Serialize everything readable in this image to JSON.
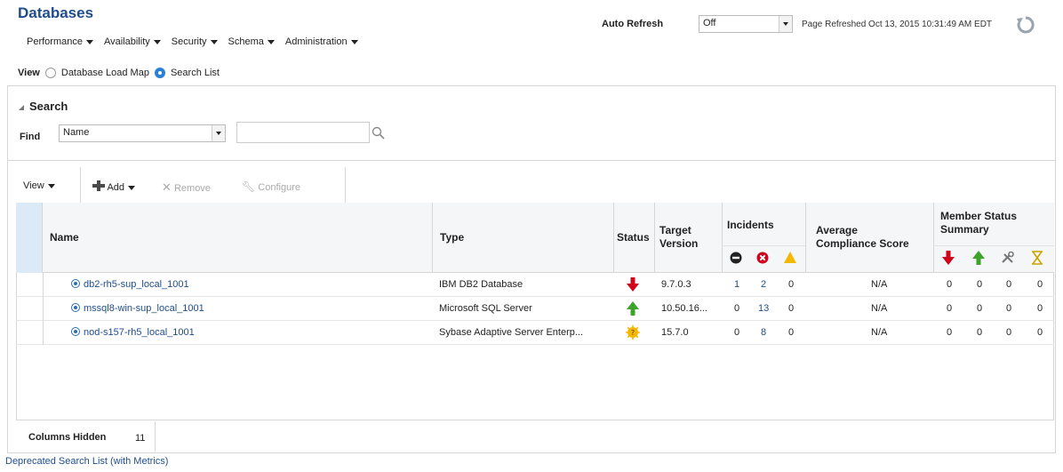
{
  "header": {
    "title": "Databases",
    "menus": [
      "Performance",
      "Availability",
      "Security",
      "Schema",
      "Administration"
    ],
    "auto_refresh_label": "Auto Refresh",
    "auto_refresh_value": "Off",
    "page_refreshed": "Page Refreshed Oct 13, 2015 10:31:49 AM EDT"
  },
  "view": {
    "label": "View",
    "options": [
      {
        "label": "Database Load Map",
        "selected": false
      },
      {
        "label": "Search List",
        "selected": true
      }
    ]
  },
  "search": {
    "title": "Search",
    "find_label": "Find",
    "field_value": "Name",
    "query": ""
  },
  "toolbar": {
    "view": "View",
    "add": "Add",
    "remove": "Remove",
    "configure": "Configure"
  },
  "table": {
    "headers": {
      "name": "Name",
      "type": "Type",
      "status": "Status",
      "target_version": [
        "Target",
        "Version"
      ],
      "incidents": "Incidents",
      "avg_compliance": [
        "Average",
        "Compliance Score"
      ],
      "member_status": [
        "Member Status",
        "Summary"
      ]
    },
    "rows": [
      {
        "name": "db2-rh5-sup_local_1001",
        "type": "IBM DB2 Database",
        "status": "down",
        "version": "9.7.0.3",
        "inc_fatal": "1",
        "inc_critical": "2",
        "inc_warning": "0",
        "compliance": "N/A",
        "m_down": "0",
        "m_up": "0",
        "m_maint": "0",
        "m_pending": "0"
      },
      {
        "name": "mssql8-win-sup_local_1001",
        "type": "Microsoft SQL Server",
        "status": "up",
        "version": "10.50.16...",
        "inc_fatal": "0",
        "inc_critical": "13",
        "inc_warning": "0",
        "compliance": "N/A",
        "m_down": "0",
        "m_up": "0",
        "m_maint": "0",
        "m_pending": "0"
      },
      {
        "name": "nod-s157-rh5_local_1001",
        "type": "Sybase Adaptive Server Enterp...",
        "status": "unknown",
        "version": "15.7.0",
        "inc_fatal": "0",
        "inc_critical": "8",
        "inc_warning": "0",
        "compliance": "N/A",
        "m_down": "0",
        "m_up": "0",
        "m_maint": "0",
        "m_pending": "0"
      }
    ]
  },
  "footer": {
    "columns_hidden_label": "Columns Hidden",
    "columns_hidden_value": "11",
    "deprecated_link": "Deprecated Search List (with Metrics)"
  },
  "colors": {
    "title": "#1f4d8c",
    "link": "#1f4d8c",
    "down": "#d0021b",
    "up": "#3ea32a",
    "warning": "#f5b800"
  }
}
